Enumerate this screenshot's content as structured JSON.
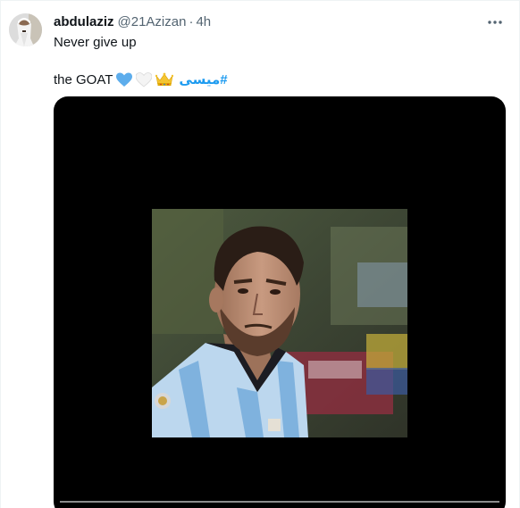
{
  "tweet": {
    "author_name": "abdulaziz",
    "handle": "@21Azizan",
    "separator": "·",
    "time": "4h",
    "text_line1": "Never give up",
    "text_line2": "the GOAT",
    "hashtag": "#ميسى",
    "emojis": [
      "blue-heart-icon",
      "white-heart-icon",
      "crown-icon"
    ]
  },
  "colors": {
    "accent": "#1d9bf0",
    "text": "#0f1419",
    "secondary": "#536471",
    "media_bg": "#000000"
  },
  "media": {
    "type": "video",
    "description_icon": "video-frame"
  }
}
